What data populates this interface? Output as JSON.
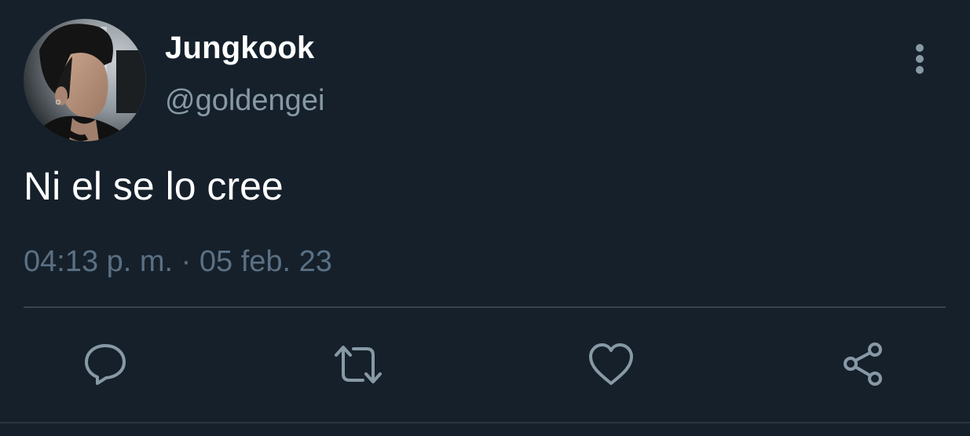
{
  "tweet": {
    "display_name": "Jungkook",
    "handle": "@goldengei",
    "text": "Ni el se lo cree",
    "timestamp": "04:13 p. m. · 05 feb. 23"
  },
  "icons": {
    "more": "more-vertical-icon",
    "reply": "reply-icon",
    "retweet": "retweet-icon",
    "like": "heart-icon",
    "share": "share-icon"
  },
  "colors": {
    "background": "#15202b",
    "primary_text": "#ffffff",
    "secondary_text": "#8899a6",
    "icon": "#8899a6",
    "divider": "#38444d"
  }
}
